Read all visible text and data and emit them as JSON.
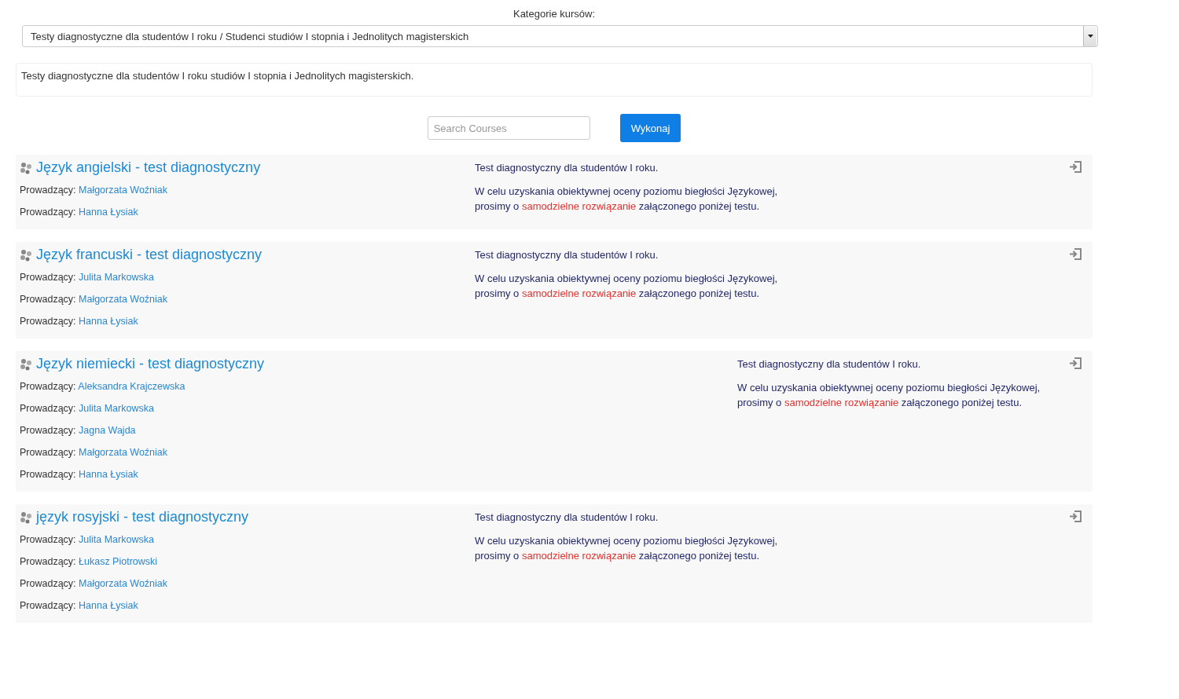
{
  "category": {
    "label": "Kategorie kursów:",
    "value": "Testy diagnostyczne dla studentów I roku / Studenci studiów I stopnia i Jednolitych magisterskich"
  },
  "description": "Testy diagnostyczne dla studentów I roku studiów I stopnia i Jednolitych magisterskich.",
  "search": {
    "placeholder": "Search Courses",
    "button": "Wykonaj"
  },
  "courses": [
    {
      "kind": "standard",
      "title": "Język angielski - test diagnostyczny",
      "teachers": [
        {
          "label": "Prowadzący:",
          "name": "Małgorzata Woźniak"
        },
        {
          "label": "Prowadzący:",
          "name": "Hanna Łysiak"
        }
      ],
      "summary": [
        [
          {
            "text": "Test diagnostyczny dla studentów I roku.",
            "highlight": false
          }
        ],
        [
          {
            "text": "W celu uzyskania obiektywnej oceny poziomu biegłości Językowej,",
            "highlight": false
          }
        ],
        [
          {
            "text": "prosimy o",
            "highlight": false
          },
          {
            "text": "samodzielne rozwiązanie",
            "highlight": true
          },
          {
            "text": "załączonego poniżej testu.",
            "highlight": false
          }
        ]
      ]
    },
    {
      "kind": "standard",
      "title": "Język francuski - test diagnostyczny",
      "teachers": [
        {
          "label": "Prowadzący:",
          "name": "Julita Markowska"
        },
        {
          "label": "Prowadzący:",
          "name": "Małgorzata Woźniak"
        },
        {
          "label": "Prowadzący:",
          "name": "Hanna Łysiak"
        }
      ],
      "summary": [
        [
          {
            "text": "Test diagnostyczny dla studentów I roku.",
            "highlight": false
          }
        ],
        [
          {
            "text": "W celu uzyskania obiektywnej oceny poziomu biegłości Językowej,",
            "highlight": false
          }
        ],
        [
          {
            "text": "prosimy o",
            "highlight": false
          },
          {
            "text": "samodzielne rozwiązanie",
            "highlight": true
          },
          {
            "text": "załączonego poniżej testu.",
            "highlight": false
          }
        ]
      ]
    },
    {
      "kind": "wide",
      "title": "Język niemiecki - test diagnostyczny",
      "teachers": [
        {
          "label": "Prowadzący:",
          "name": "Aleksandra Krajczewska"
        },
        {
          "label": "Prowadzący:",
          "name": "Julita Markowska"
        },
        {
          "label": "Prowadzący:",
          "name": "Jagna Wajda"
        },
        {
          "label": "Prowadzący:",
          "name": "Małgorzata Woźniak"
        },
        {
          "label": "Prowadzący:",
          "name": "Hanna Łysiak"
        }
      ],
      "summary": [
        [
          {
            "text": "Test diagnostyczny dla studentów I roku.",
            "highlight": false
          }
        ],
        [
          {
            "text": "W celu uzyskania obiektywnej oceny poziomu biegłości Językowej,",
            "highlight": false
          }
        ],
        [
          {
            "text": "prosimy o",
            "highlight": false
          },
          {
            "text": "samodzielne rozwiązanie",
            "highlight": true
          },
          {
            "text": "załączonego poniżej testu.",
            "highlight": false
          }
        ]
      ]
    },
    {
      "kind": "standard",
      "title": "język rosyjski - test diagnostyczny",
      "teachers": [
        {
          "label": "Prowadzący:",
          "name": "Julita Markowska"
        },
        {
          "label": "Prowadzący:",
          "name": "Łukasz Piotrowski"
        },
        {
          "label": "Prowadzący:",
          "name": "Małgorzata Woźniak"
        },
        {
          "label": "Prowadzący:",
          "name": "Hanna Łysiak"
        }
      ],
      "summary": [
        [
          {
            "text": "Test diagnostyczny dla studentów I roku.",
            "highlight": false
          }
        ],
        [
          {
            "text": "W celu uzyskania obiektywnej oceny poziomu biegłości Językowej,",
            "highlight": false
          }
        ],
        [
          {
            "text": "prosimy o",
            "highlight": false
          },
          {
            "text": "samodzielne rozwiązanie",
            "highlight": true
          },
          {
            "text": "załączonego poniżej testu.",
            "highlight": false
          }
        ]
      ]
    }
  ]
}
